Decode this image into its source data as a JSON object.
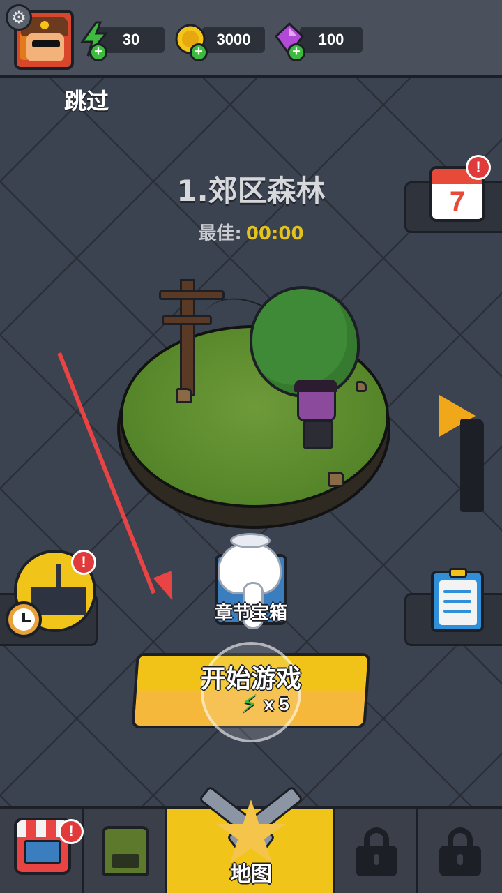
{
  "header": {
    "energy": "30",
    "coins": "3000",
    "gems": "100",
    "settings_icon": "gear-icon",
    "energy_icon": "lightning-icon",
    "coin_icon": "coin-icon",
    "gem_icon": "gem-icon"
  },
  "skip_label": "跳过",
  "stage": {
    "title": "1.郊区森林",
    "best_label": "最佳:",
    "best_time": "00:00"
  },
  "side_buttons": {
    "calendar_day": "7",
    "calendar_badge": "!",
    "ship_badge": "!"
  },
  "chest_label": "章节宝箱",
  "start": {
    "label": "开始游戏",
    "cost": "x 5"
  },
  "bottom_nav": {
    "shop_badge": "!",
    "map_label": "地图",
    "active_tab": "map"
  },
  "colors": {
    "accent": "#f0c419",
    "alert": "#e03a3a",
    "tutorial_arrow": "#e84444"
  }
}
